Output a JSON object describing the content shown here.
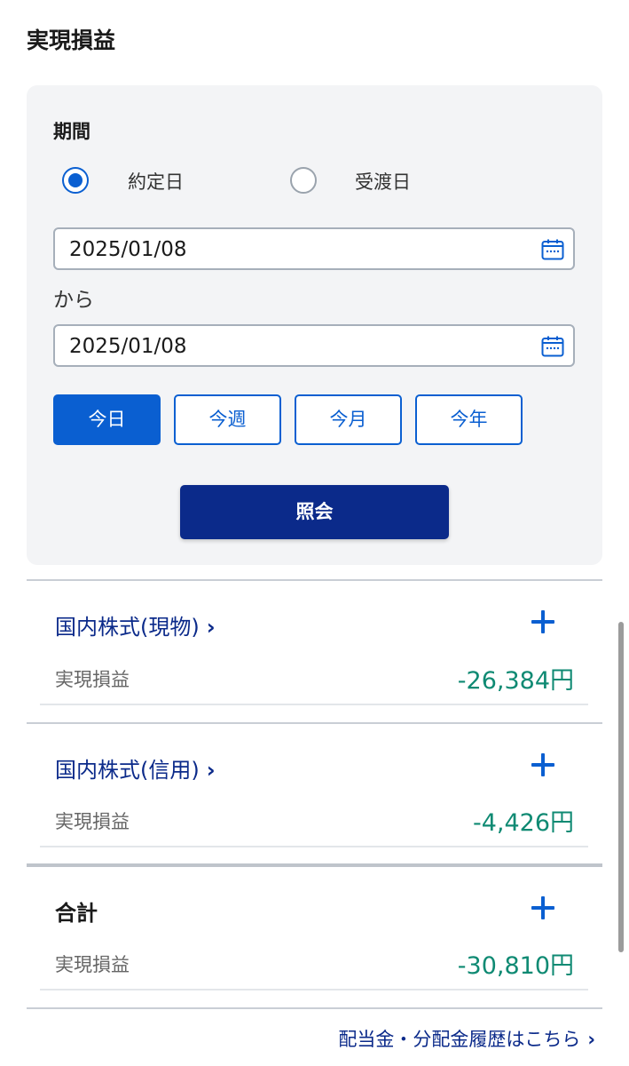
{
  "page": {
    "title": "実現損益"
  },
  "filter": {
    "period_label": "期間",
    "radio_trade_date": "約定日",
    "radio_settle_date": "受渡日",
    "selected_radio": "約定日",
    "date_from": "2025/01/08",
    "from_suffix": "から",
    "date_to": "2025/01/08",
    "quick_buttons": [
      "今日",
      "今週",
      "今月",
      "今年"
    ],
    "active_quick": "今日",
    "query_button": "照会"
  },
  "sections": [
    {
      "title": "国内株式(現物)",
      "chevron": "›",
      "label": "実現損益",
      "value": "-26,384円"
    },
    {
      "title": "国内株式(信用)",
      "chevron": "›",
      "label": "実現損益",
      "value": "-4,426円"
    }
  ],
  "total": {
    "title": "合計",
    "label": "実現損益",
    "value": "-30,810円"
  },
  "footer": {
    "history_link": "配当金・分配金履歴はこちら",
    "chevron": "›"
  },
  "icons": {
    "calendar": "calendar-icon",
    "expand": "plus-icon",
    "chevron": "chevron-right-icon"
  },
  "colors": {
    "primary": "#0a5fd1",
    "navy": "#0b2a8a",
    "value_green": "#0f8a73",
    "panel_bg": "#f3f4f6"
  }
}
